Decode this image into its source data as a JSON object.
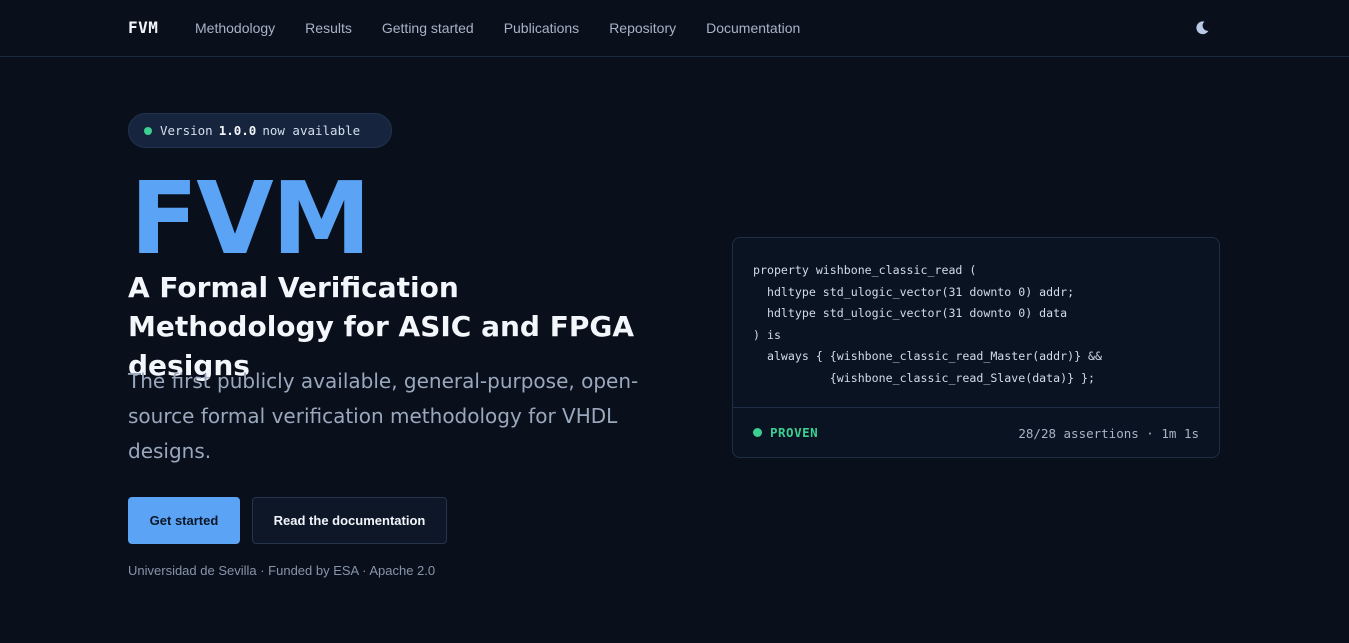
{
  "nav": {
    "logo": "FVM",
    "links": [
      "Methodology",
      "Results",
      "Getting started",
      "Publications",
      "Repository",
      "Documentation"
    ],
    "theme_icon": "moon-icon"
  },
  "badge": {
    "prefix": "Version",
    "version": "1.0.0",
    "suffix": "now available",
    "dot_color": "#3ccf91"
  },
  "hero": {
    "title": "FVM",
    "subtitle": "A Formal Verification Methodology for ASIC and FPGA designs",
    "lead": "The first publicly available, general-purpose, open-source formal verification methodology for VHDL designs.",
    "primary_button": "Get started",
    "secondary_button": "Read the documentation",
    "footnote": "Universidad de Sevilla · Funded by ESA · Apache 2.0"
  },
  "code_card": {
    "lines": [
      "property wishbone_classic_read (",
      "  hdltype std_ulogic_vector(31 downto 0) addr;",
      "  hdltype std_ulogic_vector(31 downto 0) data",
      ") is",
      "  always { {wishbone_classic_read_Master(addr)} &&",
      "           {wishbone_classic_read_Slave(data)} };"
    ],
    "status": "PROVEN",
    "assertions": "28/28 assertions · 1m 1s"
  },
  "colors": {
    "background": "#0a0f1c",
    "accent": "#5ba4f5",
    "success": "#3ccf91"
  }
}
